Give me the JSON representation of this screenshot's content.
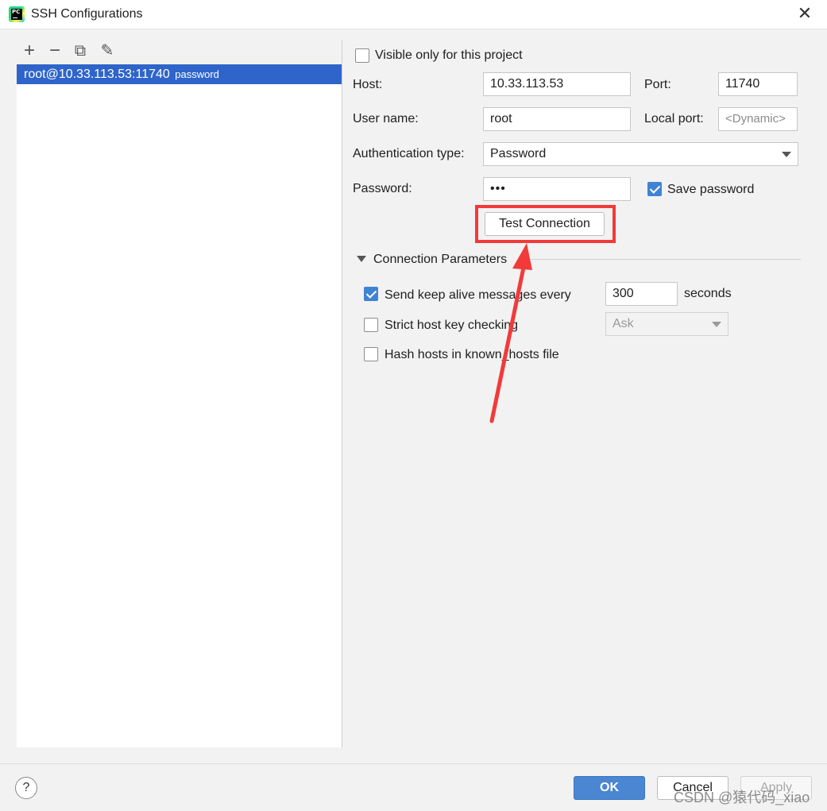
{
  "window": {
    "title": "SSH Configurations",
    "app_icon_text": "PC"
  },
  "toolbar": {
    "add": "+",
    "remove": "−",
    "copy": "⧉",
    "edit": "✎"
  },
  "configs": [
    {
      "name": "root@10.33.113.53:11740",
      "auth": "password"
    }
  ],
  "form": {
    "visible_only_label": "Visible only for this project",
    "visible_only_checked": false,
    "host_label": "Host:",
    "host_value": "10.33.113.53",
    "port_label": "Port:",
    "port_value": "11740",
    "username_label": "User name:",
    "username_value": "root",
    "local_port_label": "Local port:",
    "local_port_placeholder": "<Dynamic>",
    "auth_type_label": "Authentication type:",
    "auth_type_value": "Password",
    "password_label": "Password:",
    "password_value": "•••",
    "save_password_label": "Save password",
    "save_password_checked": true,
    "test_connection_label": "Test Connection"
  },
  "connection_parameters": {
    "title": "Connection Parameters",
    "keep_alive_label": "Send keep alive messages every",
    "keep_alive_checked": true,
    "keep_alive_value": "300",
    "keep_alive_unit": "seconds",
    "strict_host_label": "Strict host key checking",
    "strict_host_checked": false,
    "strict_host_value": "Ask",
    "hash_hosts_label": "Hash hosts in known_hosts file",
    "hash_hosts_checked": false
  },
  "footer": {
    "help": "?",
    "ok": "OK",
    "cancel": "Cancel",
    "apply": "Apply"
  },
  "watermark": "CSDN @猿代码_xiao",
  "colors": {
    "selection": "#2f65ca",
    "checkbox_checked": "#4083d4",
    "ok_button": "#4a86d2",
    "annotation_red": "#f23a3a"
  }
}
